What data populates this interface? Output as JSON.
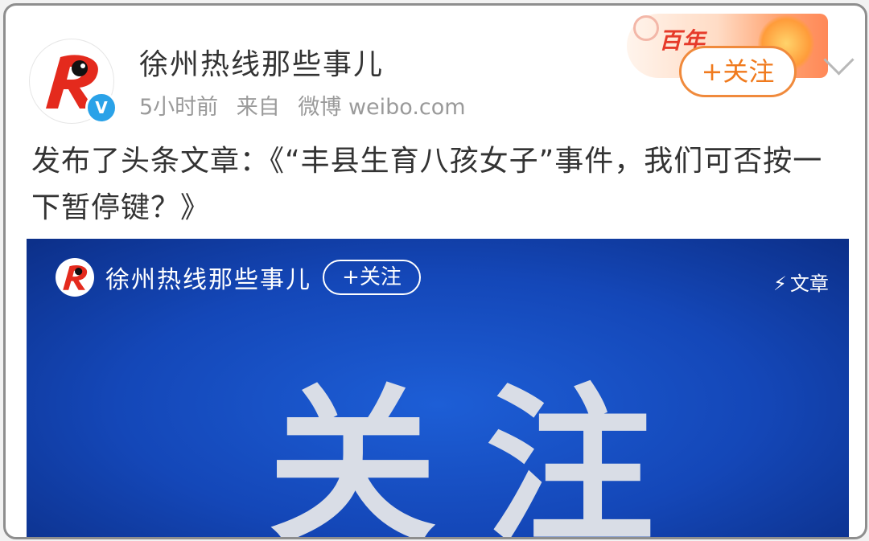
{
  "post": {
    "author_name": "徐州热线那些事儿",
    "time": "5小时前",
    "source_label": "来自",
    "source_name": "微博 weibo.com",
    "follow_label": "+关注",
    "banner_text": "百年",
    "verified_mark": "V",
    "text": "发布了头条文章：《“丰县生育八孩女子”事件，我们可否按一下暂停键？》"
  },
  "card": {
    "author_name": "徐州热线那些事儿",
    "follow_label": "+关注",
    "badge_label": "文章",
    "headline": "关注"
  },
  "colors": {
    "accent_orange": "#f07a1d",
    "verified_blue": "#2aa2e8",
    "card_blue": "#1447b8",
    "logo_red": "#e42a1d"
  }
}
